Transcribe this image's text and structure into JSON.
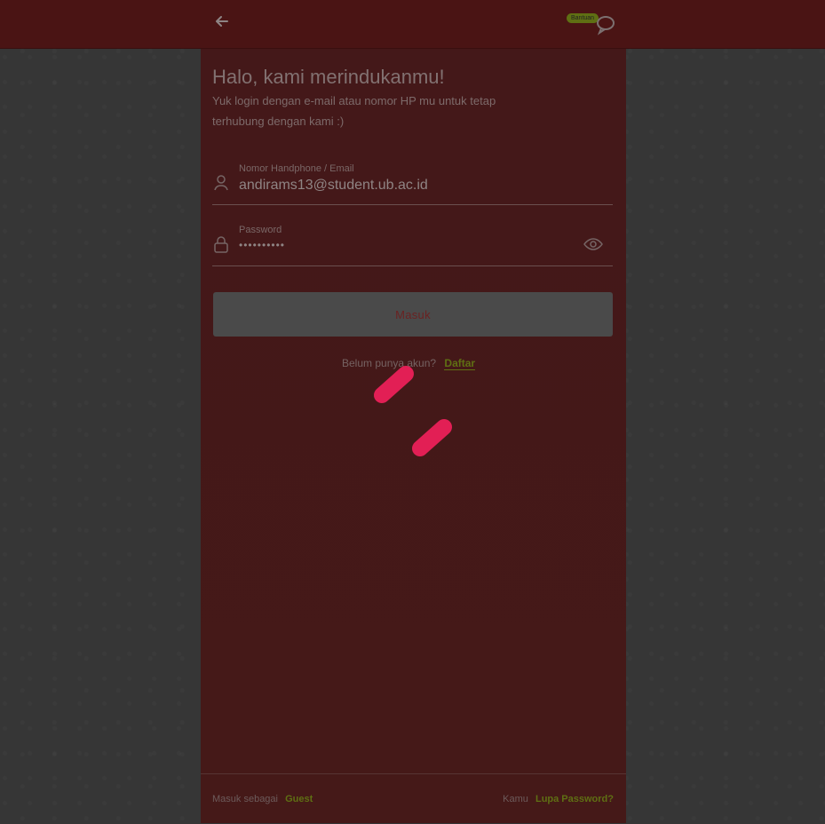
{
  "header": {
    "back_label": "←",
    "help_badge": "Bantuan"
  },
  "login": {
    "title": "Halo, kami merindukanmu!",
    "subtitle": "Yuk login dengan e-mail atau nomor HP mu untuk tetap terhubung dengan kami :)",
    "email_label": "Nomor Handphone / Email",
    "email_value": "andirams13@student.ub.ac.id",
    "password_label": "Password",
    "password_value": "••••••••••",
    "submit_label": "Masuk",
    "register_prompt": "Belum punya akun?",
    "register_link": "Daftar"
  },
  "footer": {
    "guest_prefix": "Masuk sebagai",
    "guest_link": "Guest",
    "forgot_prefix": "Kamu",
    "forgot_link": "Lupa Password?"
  },
  "colors": {
    "accent": "#5f6f13",
    "spinner": "#e21f55"
  }
}
